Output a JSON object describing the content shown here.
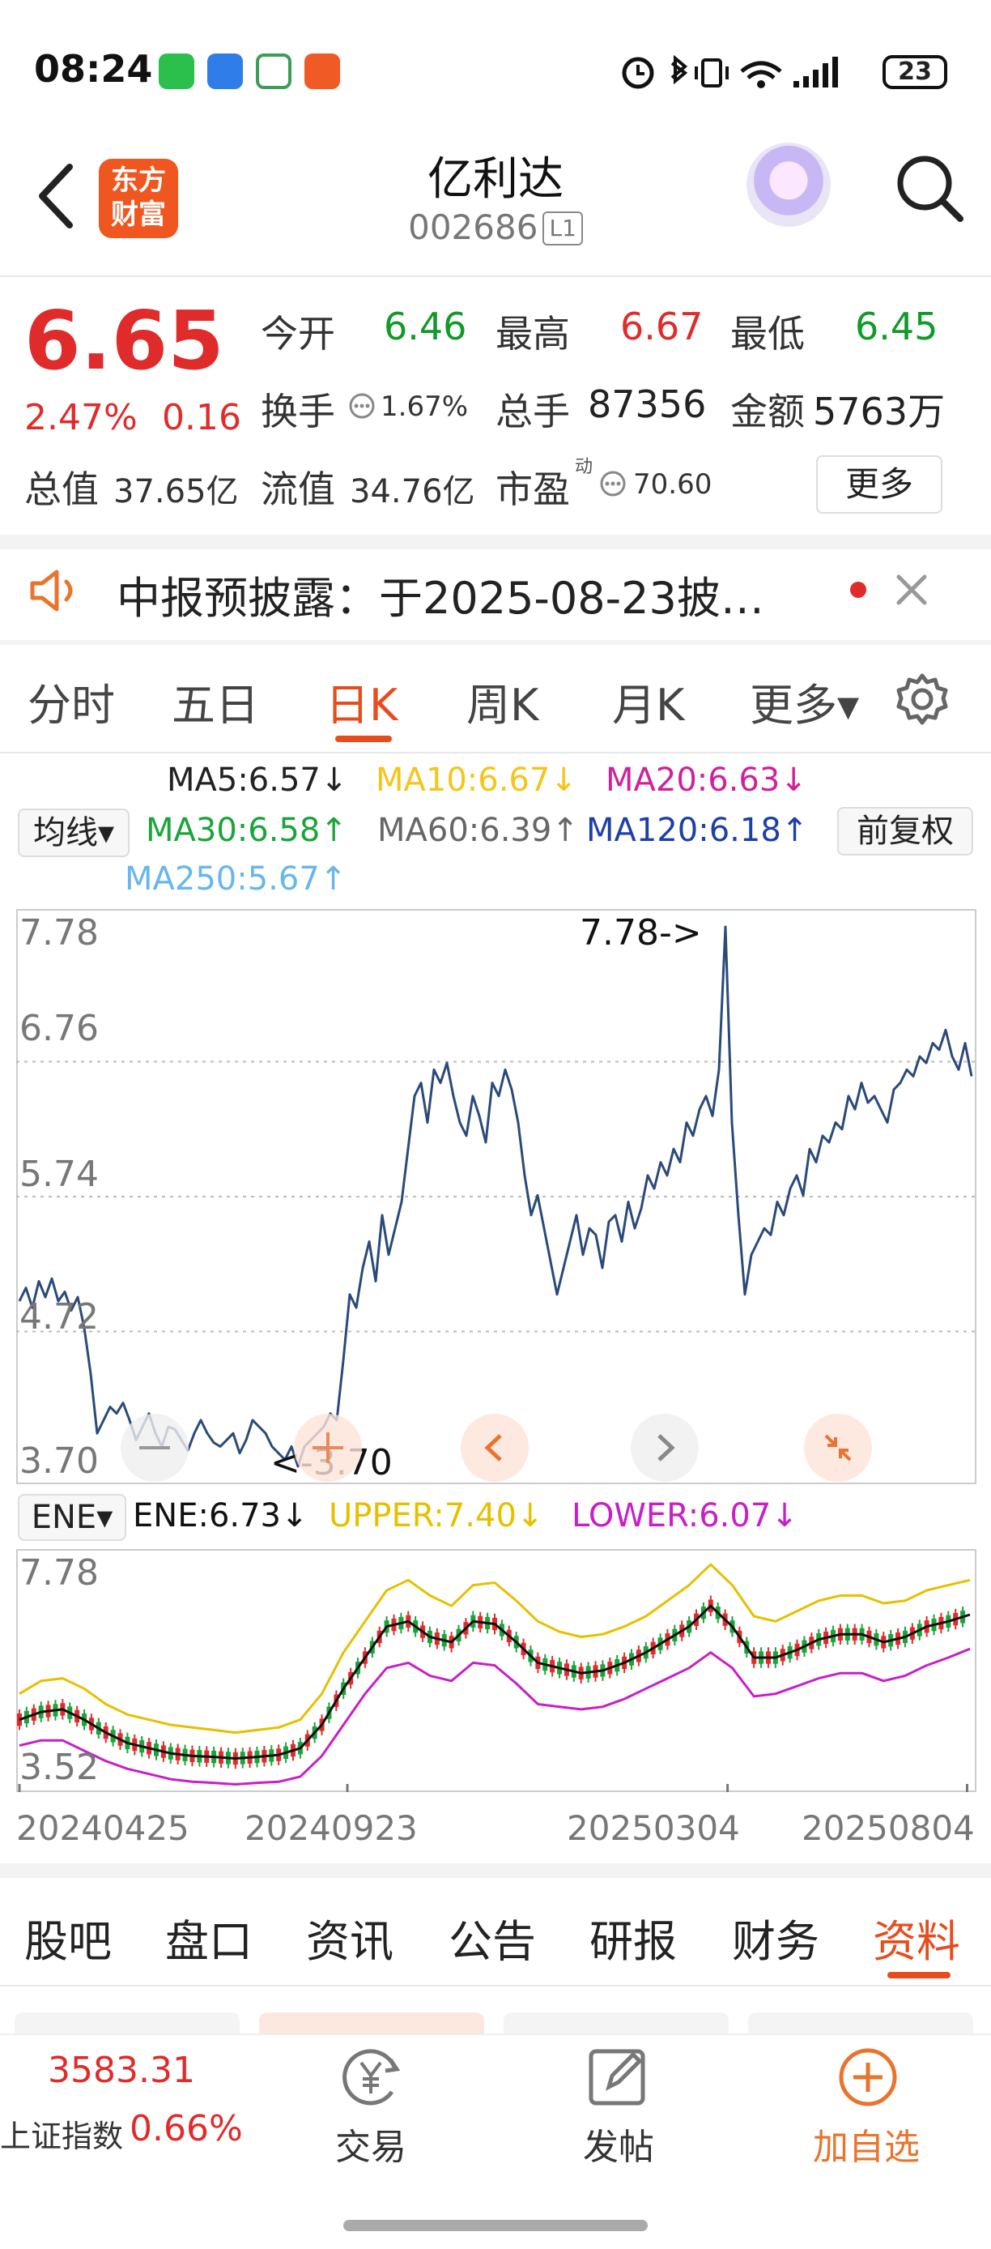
{
  "status_bar": {
    "time": "08:24",
    "battery": "23",
    "icons": [
      "wechat-icon",
      "message-icon",
      "app-icon",
      "app-icon",
      "alarm-icon",
      "bluetooth-icon",
      "vibrate-icon",
      "wifi-icon",
      "signal-icon"
    ]
  },
  "header": {
    "brand_line1": "东方",
    "brand_line2": "财富",
    "stock_name": "亿利达",
    "stock_code": "002686",
    "market_badge": "L1"
  },
  "quote": {
    "price": "6.65",
    "change_pct": "2.47%",
    "change_val": "0.16",
    "open_label": "今开",
    "open": "6.46",
    "high_label": "最高",
    "high": "6.67",
    "low_label": "最低",
    "low": "6.45",
    "turnover_label": "换手",
    "turnover": "1.67%",
    "volume_label": "总手",
    "volume": "87356",
    "amount_label": "金额",
    "amount": "5763万",
    "mktcap_label": "总值",
    "mktcap": "37.65亿",
    "float_label": "流值",
    "float_cap": "34.76亿",
    "pe_label": "市盈",
    "pe_sup": "动",
    "pe": "70.60",
    "more_label": "更多"
  },
  "notice": {
    "text": "中报预披露：于2025-08-23披…"
  },
  "kline_tabs": {
    "items": [
      "分时",
      "五日",
      "日K",
      "周K",
      "月K",
      "更多▾"
    ],
    "active": "日K"
  },
  "ma": {
    "selector": "均线▾",
    "ma5": "MA5:6.57↓",
    "ma10": "MA10:6.67↓",
    "ma20": "MA20:6.63↓",
    "ma30": "MA30:6.58↑",
    "ma60": "MA60:6.39↑",
    "ma120": "MA120:6.18↑",
    "ma250": "MA250:5.67↑",
    "adjust": "前复权",
    "colors": {
      "ma5": "#222222",
      "ma10": "#f5c518",
      "ma20": "#d0219a",
      "ma30": "#1aa43a",
      "ma60": "#666666",
      "ma120": "#1d3fa8",
      "ma250": "#67b6ec"
    }
  },
  "ene": {
    "selector": "ENE▾",
    "ene": "ENE:6.73↓",
    "upper": "UPPER:7.40↓",
    "lower": "LOWER:6.07↓",
    "colors": {
      "ene": "#111111",
      "upper": "#e6c000",
      "lower": "#c81fc8"
    }
  },
  "chart_data": [
    {
      "type": "line",
      "title": "",
      "y_ticks": [
        "7.78",
        "6.76",
        "5.74",
        "4.72",
        "3.70"
      ],
      "ylim": [
        3.7,
        7.78
      ],
      "max_label": "7.78->",
      "min_label": "<-3.70",
      "color": "#2a4a7a",
      "values": [
        4.95,
        5.05,
        4.9,
        5.1,
        4.98,
        5.12,
        4.95,
        5.02,
        4.88,
        4.98,
        4.75,
        4.4,
        3.95,
        4.05,
        4.15,
        4.1,
        4.18,
        4.05,
        3.9,
        4.0,
        4.1,
        3.95,
        3.85,
        4.0,
        3.98,
        3.9,
        3.82,
        3.95,
        4.05,
        3.95,
        3.88,
        3.85,
        3.9,
        3.95,
        3.8,
        3.9,
        4.05,
        4.0,
        3.95,
        3.85,
        3.8,
        3.75,
        3.85,
        3.7,
        3.85,
        3.9,
        3.95,
        4.0,
        4.1,
        4.05,
        4.5,
        5.0,
        4.9,
        5.2,
        5.4,
        5.1,
        5.6,
        5.3,
        5.5,
        5.7,
        6.1,
        6.5,
        6.6,
        6.3,
        6.7,
        6.6,
        6.75,
        6.5,
        6.3,
        6.2,
        6.5,
        6.35,
        6.15,
        6.6,
        6.5,
        6.7,
        6.55,
        6.3,
        5.9,
        5.6,
        5.75,
        5.5,
        5.25,
        5.0,
        5.2,
        5.4,
        5.6,
        5.3,
        5.5,
        5.45,
        5.2,
        5.55,
        5.6,
        5.4,
        5.7,
        5.5,
        5.65,
        5.9,
        5.8,
        6.0,
        5.9,
        6.1,
        6.0,
        6.3,
        6.2,
        6.4,
        6.5,
        6.35,
        6.7,
        7.78,
        6.3,
        5.6,
        5.0,
        5.3,
        5.4,
        5.5,
        5.45,
        5.7,
        5.6,
        5.8,
        5.9,
        5.75,
        6.1,
        6.0,
        6.2,
        6.15,
        6.3,
        6.25,
        6.5,
        6.4,
        6.6,
        6.45,
        6.5,
        6.4,
        6.3,
        6.55,
        6.6,
        6.7,
        6.65,
        6.8,
        6.75,
        6.9,
        6.85,
        7.0,
        6.8,
        6.7,
        6.9,
        6.65
      ]
    },
    {
      "type": "line",
      "title": "ENE",
      "y_ticks": [
        "7.78",
        "3.52"
      ],
      "ylim": [
        3.52,
        7.78
      ],
      "x_ticks": [
        "20240425",
        "20240923",
        "20250304",
        "20250804"
      ],
      "series": [
        {
          "name": "UPPER",
          "color": "#e6c000",
          "values": [
            5.2,
            5.45,
            5.5,
            5.3,
            5.0,
            4.8,
            4.7,
            4.6,
            4.55,
            4.5,
            4.45,
            4.5,
            4.55,
            4.7,
            5.2,
            6.0,
            6.6,
            7.2,
            7.4,
            7.1,
            6.9,
            7.3,
            7.35,
            7.0,
            6.6,
            6.4,
            6.3,
            6.35,
            6.5,
            6.7,
            7.0,
            7.3,
            7.7,
            7.3,
            6.7,
            6.6,
            6.8,
            7.0,
            7.1,
            7.1,
            6.95,
            7.0,
            7.2,
            7.3,
            7.4
          ]
        },
        {
          "name": "ENE",
          "color": "#111111",
          "values": [
            4.7,
            4.85,
            4.9,
            4.7,
            4.45,
            4.25,
            4.15,
            4.05,
            4.0,
            3.98,
            3.95,
            3.98,
            4.02,
            4.15,
            4.6,
            5.3,
            5.9,
            6.5,
            6.6,
            6.3,
            6.2,
            6.6,
            6.55,
            6.2,
            5.8,
            5.7,
            5.6,
            5.65,
            5.8,
            6.0,
            6.25,
            6.5,
            6.9,
            6.5,
            5.9,
            5.9,
            6.05,
            6.25,
            6.35,
            6.35,
            6.2,
            6.3,
            6.5,
            6.6,
            6.73
          ]
        },
        {
          "name": "LOWER",
          "color": "#c81fc8",
          "values": [
            4.2,
            4.3,
            4.3,
            4.1,
            3.9,
            3.75,
            3.65,
            3.55,
            3.5,
            3.48,
            3.45,
            3.48,
            3.5,
            3.6,
            4.0,
            4.6,
            5.2,
            5.7,
            5.8,
            5.55,
            5.45,
            5.8,
            5.75,
            5.4,
            5.0,
            4.95,
            4.9,
            4.95,
            5.1,
            5.3,
            5.5,
            5.7,
            6.0,
            5.7,
            5.15,
            5.2,
            5.35,
            5.5,
            5.6,
            5.6,
            5.45,
            5.55,
            5.75,
            5.9,
            6.07
          ]
        }
      ]
    }
  ],
  "bottom_tabs": {
    "items": [
      "股吧",
      "盘口",
      "资讯",
      "公告",
      "研报",
      "财务",
      "资料"
    ],
    "active": "资料"
  },
  "bottom_bar": {
    "index_value": "3583.31",
    "index_name": "上证指数",
    "index_change": "0.66%",
    "trade_label": "交易",
    "post_label": "发帖",
    "watchlist_label": "加自选"
  }
}
